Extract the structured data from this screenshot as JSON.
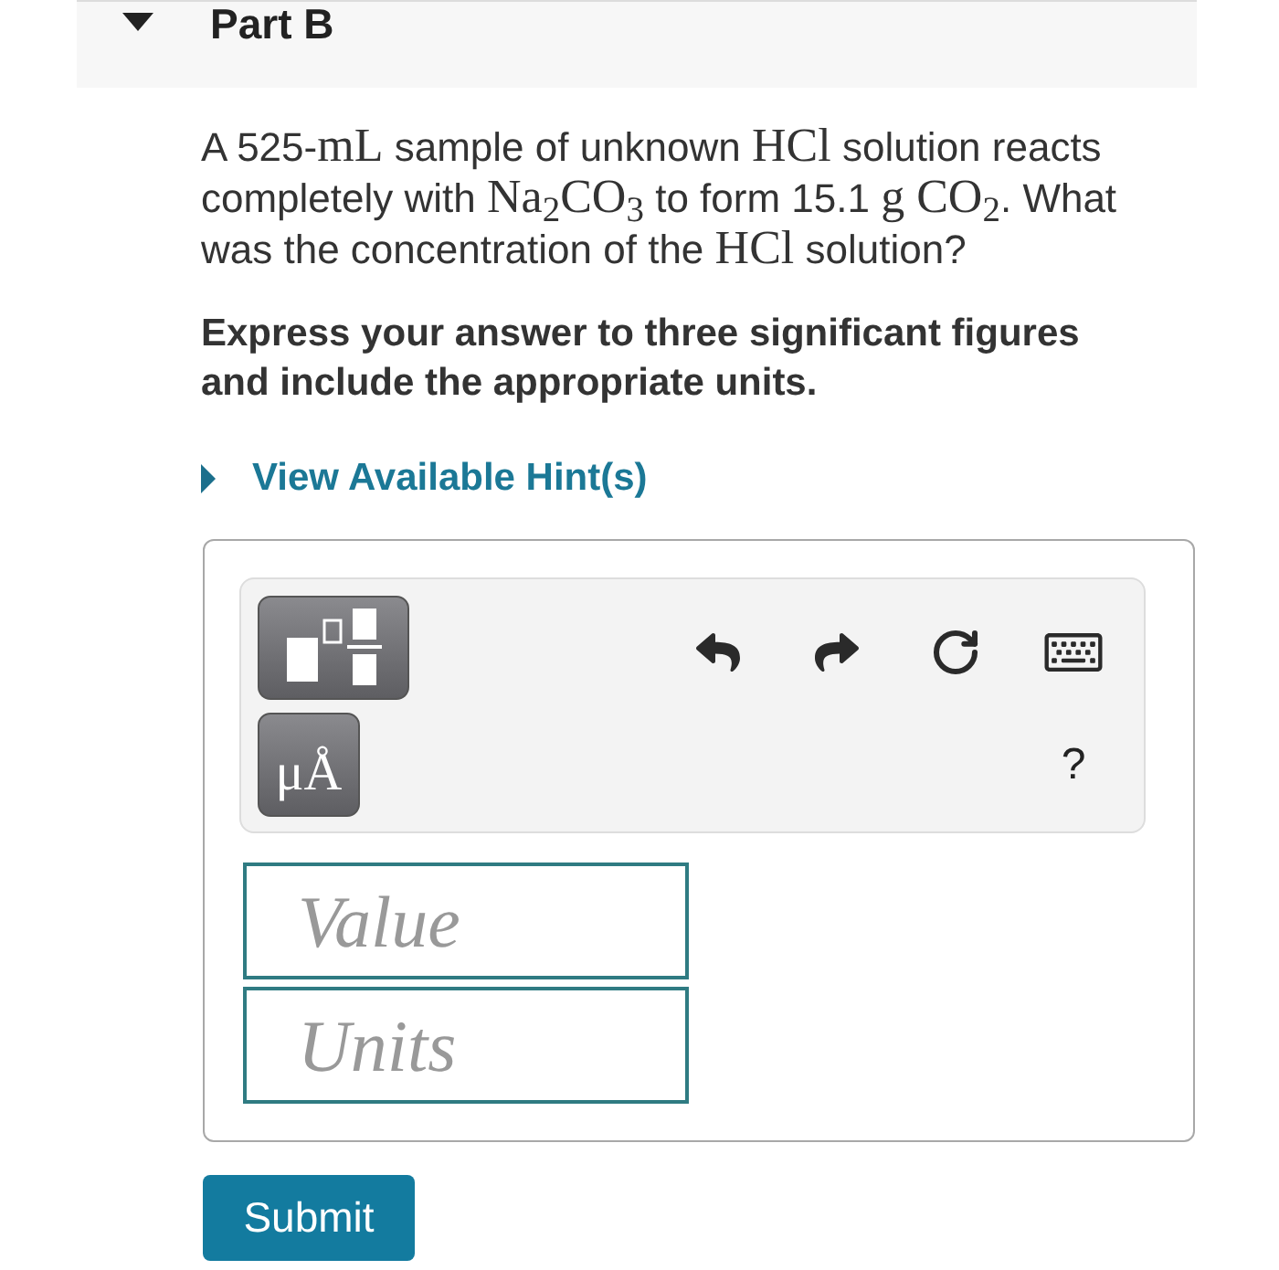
{
  "part": {
    "title": "Part B",
    "expanded": true
  },
  "question": {
    "segments": [
      {
        "kind": "text",
        "text": "A 525-"
      },
      {
        "kind": "math",
        "text": "mL"
      },
      {
        "kind": "text",
        "text": " sample of unknown "
      },
      {
        "kind": "math",
        "text": "HCl"
      },
      {
        "kind": "text",
        "text": " solution reacts completely with "
      },
      {
        "kind": "math",
        "text": "Na$_{2}$CO$_{3}$"
      },
      {
        "kind": "text",
        "text": " to form 15.1 "
      },
      {
        "kind": "math",
        "text": "g CO$_{2}$"
      },
      {
        "kind": "text",
        "text": ". What was the concentration of the "
      },
      {
        "kind": "math",
        "text": "HCl"
      },
      {
        "kind": "text",
        "text": " solution?"
      }
    ]
  },
  "instruction": "Express your answer to three significant figures and include the appropriate units.",
  "hint_link": {
    "label": "View Available Hint(s)",
    "expanded": false
  },
  "toolbar": {
    "units_button": "μÅ",
    "help": "?"
  },
  "fields": [
    {
      "placeholder": "Value"
    },
    {
      "placeholder": "Units"
    }
  ],
  "submit": "Submit"
}
